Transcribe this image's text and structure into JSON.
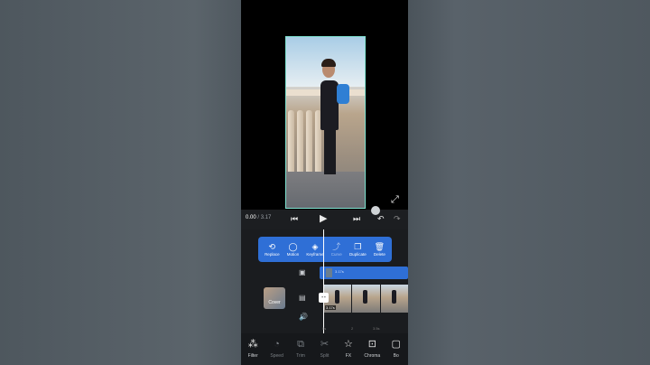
{
  "player": {
    "current_time": "0.00",
    "duration": "/ 3.17"
  },
  "popup_toolbar": [
    {
      "label": "Replace",
      "icon": "replace-icon"
    },
    {
      "label": "Motion",
      "icon": "motion-icon"
    },
    {
      "label": "Keyframe",
      "icon": "keyframe-icon"
    },
    {
      "label": "Curve",
      "icon": "curve-icon"
    },
    {
      "label": "Duplicate",
      "icon": "duplicate-icon"
    },
    {
      "label": "Delete",
      "icon": "delete-icon"
    }
  ],
  "timeline": {
    "overlay_clip_label": "3.17s",
    "cover_label": "Cover",
    "video_clip_label": "3.17s",
    "ruler": [
      "0s",
      "2",
      "3.5s"
    ]
  },
  "bottom_tools": [
    {
      "label": "Filter",
      "icon": "filter-icon"
    },
    {
      "label": "Speed",
      "icon": "speed-icon"
    },
    {
      "label": "Trim",
      "icon": "trim-icon"
    },
    {
      "label": "Split",
      "icon": "split-icon"
    },
    {
      "label": "FX",
      "icon": "fx-icon"
    },
    {
      "label": "Chroma",
      "icon": "chroma-icon"
    },
    {
      "label": "Bo",
      "icon": "border-icon"
    }
  ],
  "colors": {
    "accent": "#2f6fd6",
    "background": "#16181b",
    "frame_border": "#7ee2d0"
  }
}
